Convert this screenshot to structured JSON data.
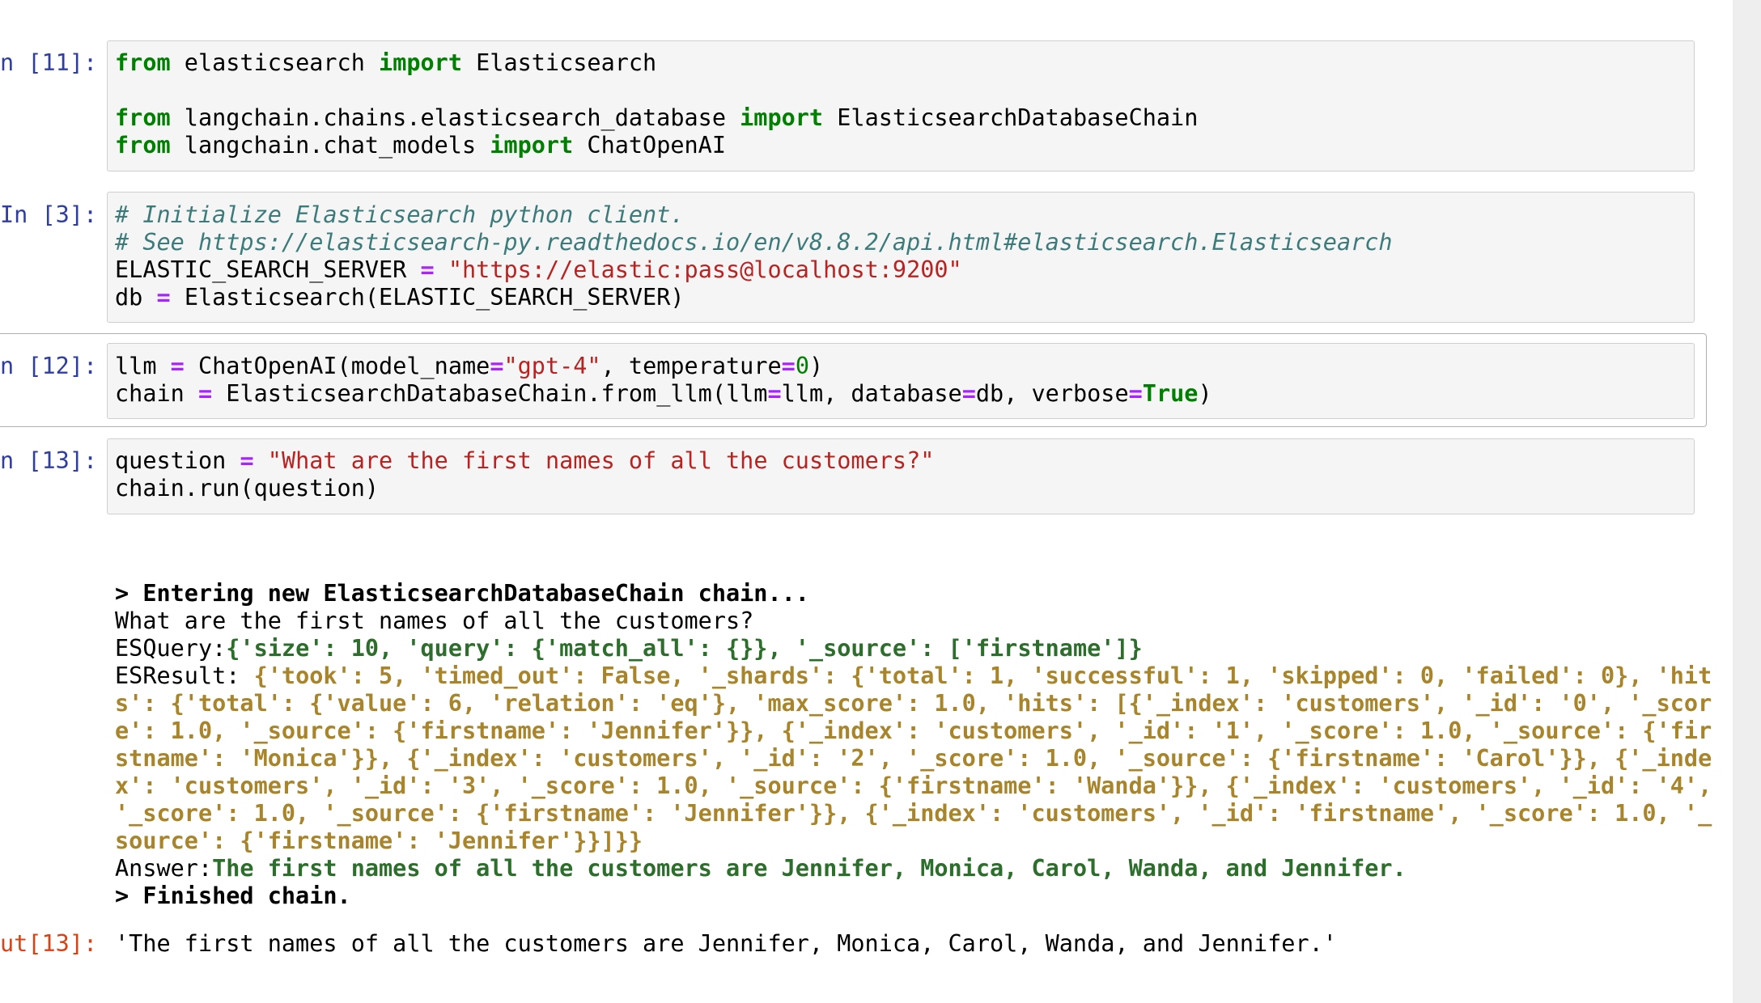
{
  "cells": [
    {
      "prompt": "n [11]:",
      "lines": [
        [
          [
            "kw",
            "from"
          ],
          [
            "t",
            " elasticsearch "
          ],
          [
            "kw",
            "import"
          ],
          [
            "t",
            " Elasticsearch"
          ]
        ],
        [],
        [
          [
            "kw",
            "from"
          ],
          [
            "t",
            " langchain.chains.elasticsearch_database "
          ],
          [
            "kw",
            "import"
          ],
          [
            "t",
            " ElasticsearchDatabaseChain"
          ]
        ],
        [
          [
            "kw",
            "from"
          ],
          [
            "t",
            " langchain.chat_models "
          ],
          [
            "kw",
            "import"
          ],
          [
            "t",
            " ChatOpenAI"
          ]
        ]
      ]
    },
    {
      "prompt": "In [3]:",
      "lines": [
        [
          [
            "cm",
            "# Initialize Elasticsearch python client."
          ]
        ],
        [
          [
            "cm",
            "# See https://elasticsearch-py.readthedocs.io/en/v8.8.2/api.html#elasticsearch.Elasticsearch"
          ]
        ],
        [
          [
            "t",
            "ELASTIC_SEARCH_SERVER "
          ],
          [
            "op",
            "="
          ],
          [
            "t",
            " "
          ],
          [
            "str",
            "\"https://elastic:pass@localhost:9200\""
          ]
        ],
        [
          [
            "t",
            "db "
          ],
          [
            "op",
            "="
          ],
          [
            "t",
            " Elasticsearch(ELASTIC_SEARCH_SERVER)"
          ]
        ]
      ]
    },
    {
      "prompt": "n [12]:",
      "lines": [
        [
          [
            "t",
            "llm "
          ],
          [
            "op",
            "="
          ],
          [
            "t",
            " ChatOpenAI(model_name"
          ],
          [
            "op",
            "="
          ],
          [
            "str",
            "\"gpt-4\""
          ],
          [
            "t",
            ", temperature"
          ],
          [
            "op",
            "="
          ],
          [
            "num",
            "0"
          ],
          [
            "t",
            ")"
          ]
        ],
        [
          [
            "t",
            "chain "
          ],
          [
            "op",
            "="
          ],
          [
            "t",
            " ElasticsearchDatabaseChain.from_llm(llm"
          ],
          [
            "op",
            "="
          ],
          [
            "t",
            "llm, database"
          ],
          [
            "op",
            "="
          ],
          [
            "t",
            "db, verbose"
          ],
          [
            "op",
            "="
          ],
          [
            "kw",
            "True"
          ],
          [
            "t",
            ")"
          ]
        ]
      ]
    },
    {
      "prompt": "n [13]:",
      "lines": [
        [
          [
            "t",
            "question "
          ],
          [
            "op",
            "="
          ],
          [
            "t",
            " "
          ],
          [
            "str",
            "\"What are the first names of all the customers?\""
          ]
        ],
        [
          [
            "t",
            "chain.run(question)"
          ]
        ]
      ]
    }
  ],
  "stream_output": [
    [
      [
        "bld",
        "> Entering new ElasticsearchDatabaseChain chain..."
      ]
    ],
    [
      [
        "t",
        "What are the first names of all the customers?"
      ]
    ],
    [
      [
        "t",
        "ESQuery:"
      ],
      [
        "grn",
        "{'size': 10, 'query': {'match_all': {}}, '_source': ['firstname']}"
      ]
    ],
    [
      [
        "t",
        "ESResult: "
      ],
      [
        "ylw",
        "{'took': 5, 'timed_out': False, '_shards': {'total': 1, 'successful': 1, 'skipped': 0, 'failed': 0}, 'hit"
      ]
    ],
    [
      [
        "ylw",
        "s': {'total': {'value': 6, 'relation': 'eq'}, 'max_score': 1.0, 'hits': [{'_index': 'customers', '_id': '0', '_scor"
      ]
    ],
    [
      [
        "ylw",
        "e': 1.0, '_source': {'firstname': 'Jennifer'}}, {'_index': 'customers', '_id': '1', '_score': 1.0, '_source': {'fir"
      ]
    ],
    [
      [
        "ylw",
        "stname': 'Monica'}}, {'_index': 'customers', '_id': '2', '_score': 1.0, '_source': {'firstname': 'Carol'}}, {'_inde"
      ]
    ],
    [
      [
        "ylw",
        "x': 'customers', '_id': '3', '_score': 1.0, '_source': {'firstname': 'Wanda'}}, {'_index': 'customers', '_id': '4',"
      ]
    ],
    [
      [
        "ylw",
        "'_score': 1.0, '_source': {'firstname': 'Jennifer'}}, {'_index': 'customers', '_id': 'firstname', '_score': 1.0, '_"
      ]
    ],
    [
      [
        "ylw",
        "source': {'firstname': 'Jennifer'}}]}}"
      ]
    ],
    [
      [
        "t",
        "Answer:"
      ],
      [
        "grn",
        "The first names of all the customers are Jennifer, Monica, Carol, Wanda, and Jennifer."
      ]
    ],
    [
      [
        "bld",
        "> Finished chain."
      ]
    ]
  ],
  "result": {
    "prompt": "ut[13]:",
    "text": "'The first names of all the customers are Jennifer, Monica, Carol, Wanda, and Jennifer.'"
  }
}
